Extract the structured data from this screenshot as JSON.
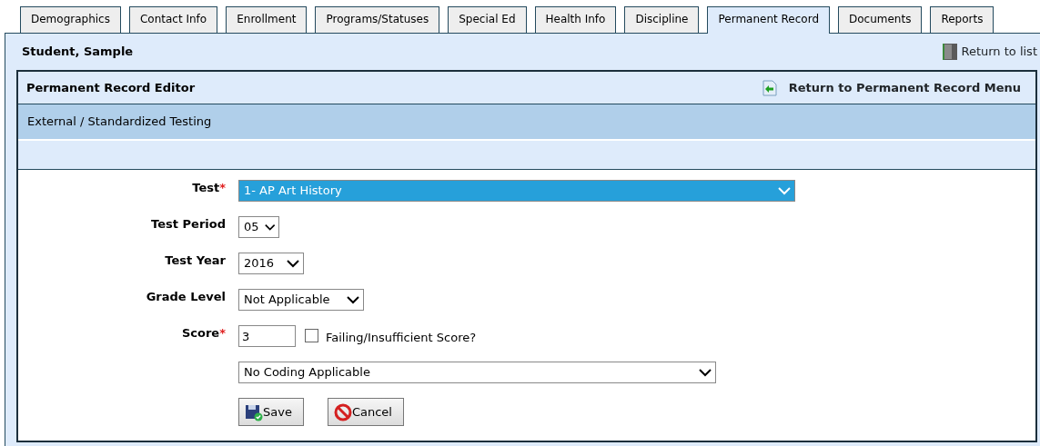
{
  "tabs": [
    {
      "label": "Demographics",
      "selected": false
    },
    {
      "label": "Contact Info",
      "selected": false
    },
    {
      "label": "Enrollment",
      "selected": false
    },
    {
      "label": "Programs/Statuses",
      "selected": false
    },
    {
      "label": "Special Ed",
      "selected": false
    },
    {
      "label": "Health Info",
      "selected": false
    },
    {
      "label": "Discipline",
      "selected": false
    },
    {
      "label": "Permanent Record",
      "selected": true
    },
    {
      "label": "Documents",
      "selected": false
    },
    {
      "label": "Reports",
      "selected": false
    }
  ],
  "student_name": "Student, Sample",
  "return_to_list": "Return to list",
  "editor": {
    "title": "Permanent Record Editor",
    "return_link": "Return to Permanent Record Menu",
    "section": "External / Standardized Testing"
  },
  "form": {
    "required_marker": "*",
    "fields": [
      {
        "label": "Test",
        "required": true,
        "kind": "select",
        "value": "1- AP Art History",
        "focused": true
      },
      {
        "label": "Test Period",
        "required": false,
        "kind": "select",
        "value": "05",
        "focused": false
      },
      {
        "label": "Test Year",
        "required": false,
        "kind": "select",
        "value": "2016",
        "focused": false
      },
      {
        "label": "Grade Level",
        "required": false,
        "kind": "select",
        "value": "Not Applicable",
        "focused": false
      },
      {
        "label": "Score",
        "required": true,
        "kind": "text",
        "value": "3",
        "focused": false
      }
    ],
    "checkbox": {
      "label": "Failing/Insufficient Score?",
      "checked": false
    },
    "coding": {
      "value": "No Coding Applicable"
    },
    "buttons": [
      {
        "label": "Save",
        "kind": "save"
      },
      {
        "label": "Cancel",
        "kind": "cancel"
      }
    ]
  }
}
